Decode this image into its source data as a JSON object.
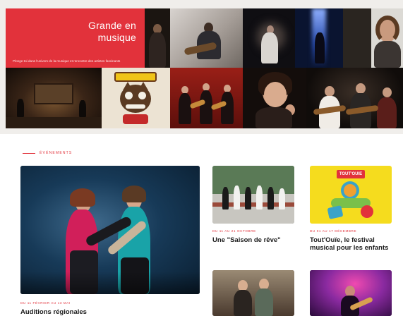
{
  "hero": {
    "title": "Grande en musique",
    "subtitle": "Plonge-toi dans l'univers de la musique et rencontre des artistes fascinants"
  },
  "section": {
    "label": "Événements"
  },
  "cards": [
    {
      "date": "DU 11 FÉVRIER AU 13 MAI",
      "title": "Auditions régionales"
    },
    {
      "date": "DU 11 AU 21 OCTOBRE",
      "title": "Une \"Saison de rêve\""
    },
    {
      "date": "DU 01 AU 17 DÉCEMBRE",
      "title": "Tout'Ouïe, le festival musical pour les enfants"
    }
  ],
  "poster": {
    "badge": "TOUT'OUIE"
  },
  "colors": {
    "accent": "#e2323b",
    "hero_bg": "#f0eeeb",
    "poster_yellow": "#f5dc1e"
  }
}
